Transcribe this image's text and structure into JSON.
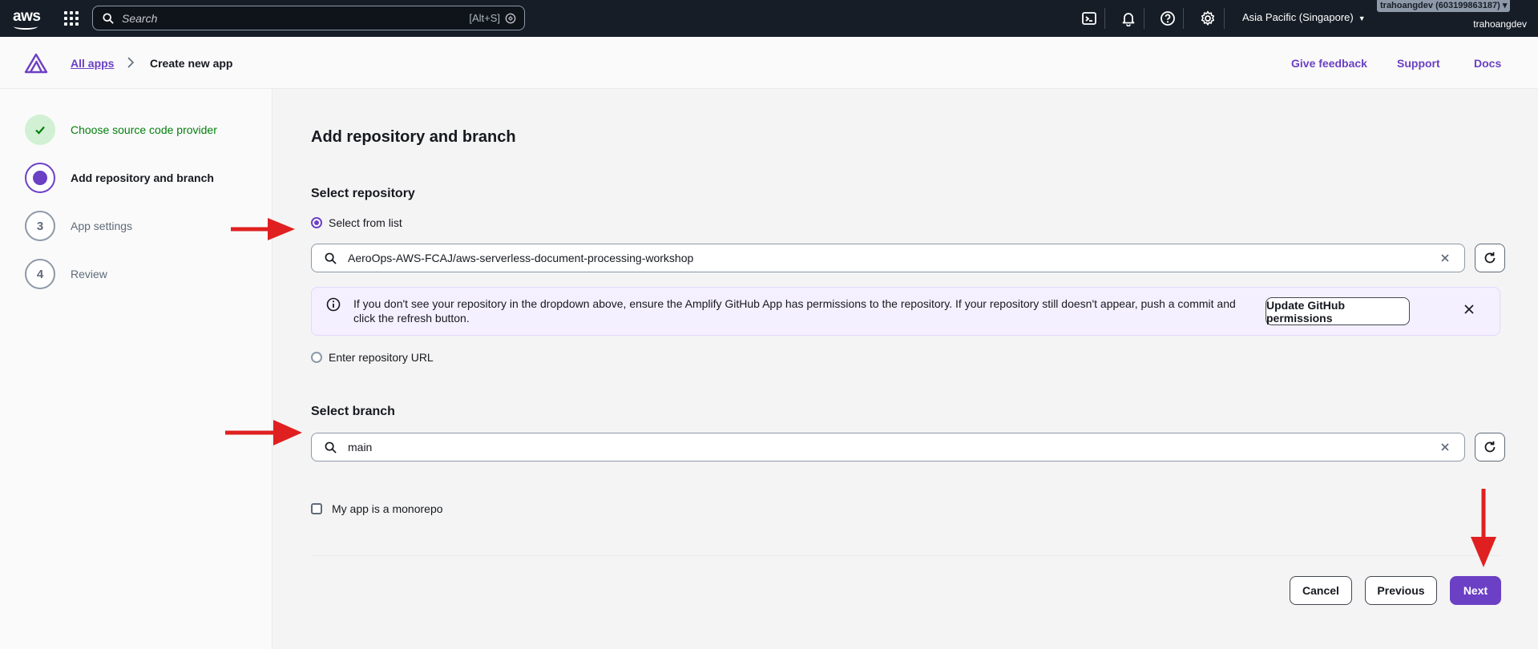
{
  "topnav": {
    "logo": "aws",
    "search_placeholder": "Search",
    "search_shortcut": "[Alt+S]",
    "region": "Asia Pacific (Singapore)",
    "account": "trahoangdev (603199863187)",
    "user": "trahoangdev",
    "icons": [
      "cloudshell-icon",
      "bell-icon",
      "help-icon",
      "gear-icon"
    ]
  },
  "header": {
    "breadcrumb_link": "All apps",
    "breadcrumb_current": "Create new app",
    "links": [
      "Give feedback",
      "Support",
      "Docs"
    ]
  },
  "steps": [
    {
      "number": "1",
      "label": "Choose source code provider",
      "state": "done"
    },
    {
      "number": "2",
      "label": "Add repository and branch",
      "state": "active"
    },
    {
      "number": "3",
      "label": "App settings",
      "state": "todo"
    },
    {
      "number": "4",
      "label": "Review",
      "state": "todo"
    }
  ],
  "main": {
    "title": "Add repository and branch",
    "repo_section_title": "Select repository",
    "radio_from_list": "Select from list",
    "repo_value": "AeroOps-AWS-FCAJ/aws-serverless-document-processing-workshop",
    "alert_text": "If you don't see your repository in the dropdown above, ensure the Amplify GitHub App has permissions to the repository. If your repository still doesn't appear, push a commit and click the refresh button.",
    "alert_button": "Update GitHub permissions",
    "radio_url": "Enter repository URL",
    "branch_section_title": "Select branch",
    "branch_value": "main",
    "monorepo_label": "My app is a monorepo",
    "cancel": "Cancel",
    "previous": "Previous",
    "next": "Next"
  },
  "colors": {
    "accent": "#6b40c4",
    "annotation_arrow": "#e02020",
    "topnav_bg": "#161d26"
  }
}
